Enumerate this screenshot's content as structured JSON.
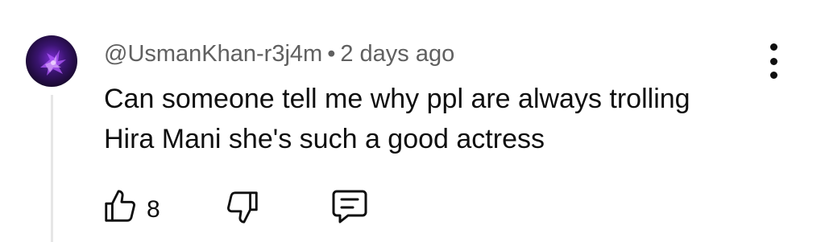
{
  "comment": {
    "author_handle": "@UsmanKhan-r3j4m",
    "separator": "•",
    "timestamp": "2 days ago",
    "text_lines": [
      "Can someone tell me why ppl are always trolling",
      "Hira Mani she's such a good actress"
    ],
    "like_count": "8"
  },
  "icons": {
    "avatar": "avatar-image",
    "more": "vertical-ellipsis-icon",
    "like": "thumbs-up-icon",
    "dislike": "thumbs-down-icon",
    "reply": "comment-bubble-icon"
  },
  "colors": {
    "background": "#ffffff",
    "text_primary": "#0f0f0f",
    "text_secondary": "#606060",
    "thread_line": "#e6e6e6",
    "avatar_bg": "#1a0a2e",
    "avatar_accent": "#9b3dff"
  }
}
